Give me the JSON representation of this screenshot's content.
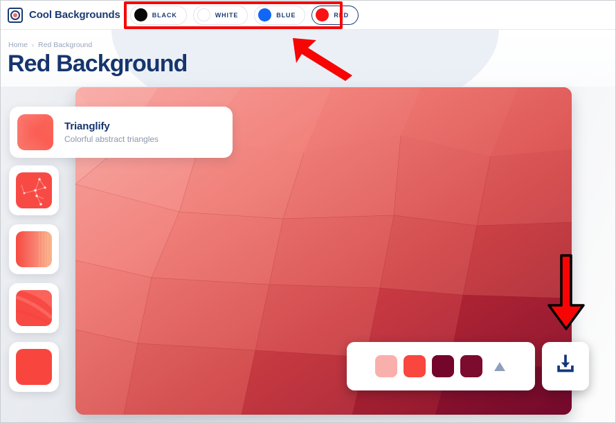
{
  "brand": {
    "name": "Cool Backgrounds",
    "logo_icon": "circle-target-icon"
  },
  "filters": {
    "chips": [
      {
        "label": "BLACK",
        "color": "#070707",
        "active": false,
        "outlined": false
      },
      {
        "label": "WHITE",
        "color": "#ffffff",
        "active": false,
        "outlined": true
      },
      {
        "label": "BLUE",
        "color": "#1166f5",
        "active": false,
        "outlined": false
      },
      {
        "label": "RED",
        "color": "#f91313",
        "active": true,
        "outlined": false
      }
    ],
    "highlight_color": "#f70505"
  },
  "breadcrumb": {
    "home": "Home",
    "separator": "›",
    "current": "Red Background"
  },
  "header": {
    "title": "Red Background",
    "title_color": "#16356e"
  },
  "pattern_card": {
    "title": "Trianglify",
    "subtitle": "Colorful abstract triangles",
    "thumb_name": "trianglify-thumb"
  },
  "thumbnails": [
    {
      "name": "low-poly-network-thumb",
      "style": "network"
    },
    {
      "name": "gradient-stripes-thumb",
      "style": "stripes"
    },
    {
      "name": "soft-curves-thumb",
      "style": "curves"
    },
    {
      "name": "solid-color-thumb",
      "style": "solid"
    }
  ],
  "palette": {
    "swatches": [
      {
        "name": "swatch-light-pink",
        "color": "#f9b0ac"
      },
      {
        "name": "swatch-bright-red",
        "color": "#f9463f"
      },
      {
        "name": "swatch-dark-maroon",
        "color": "#73062a"
      },
      {
        "name": "swatch-deep-maroon",
        "color": "#7c0b2e"
      }
    ],
    "expand_icon": "triangle-up-icon",
    "expand_color": "#8fa0bd"
  },
  "download": {
    "icon": "download-icon",
    "icon_color": "#11377c"
  },
  "annotations": {
    "arrow_to_chips": "arrow-up-left",
    "arrow_to_download": "arrow-down",
    "arrow_color": "#f70505",
    "arrow_outline": "#000000"
  },
  "preview": {
    "name": "red-trianglify-preview",
    "colors": [
      "#f7a6a3",
      "#f48d88",
      "#ee6b64",
      "#e04f49",
      "#cf3b38",
      "#b52b2e",
      "#9b1c2b",
      "#7c0b2e",
      "#66062a"
    ]
  }
}
